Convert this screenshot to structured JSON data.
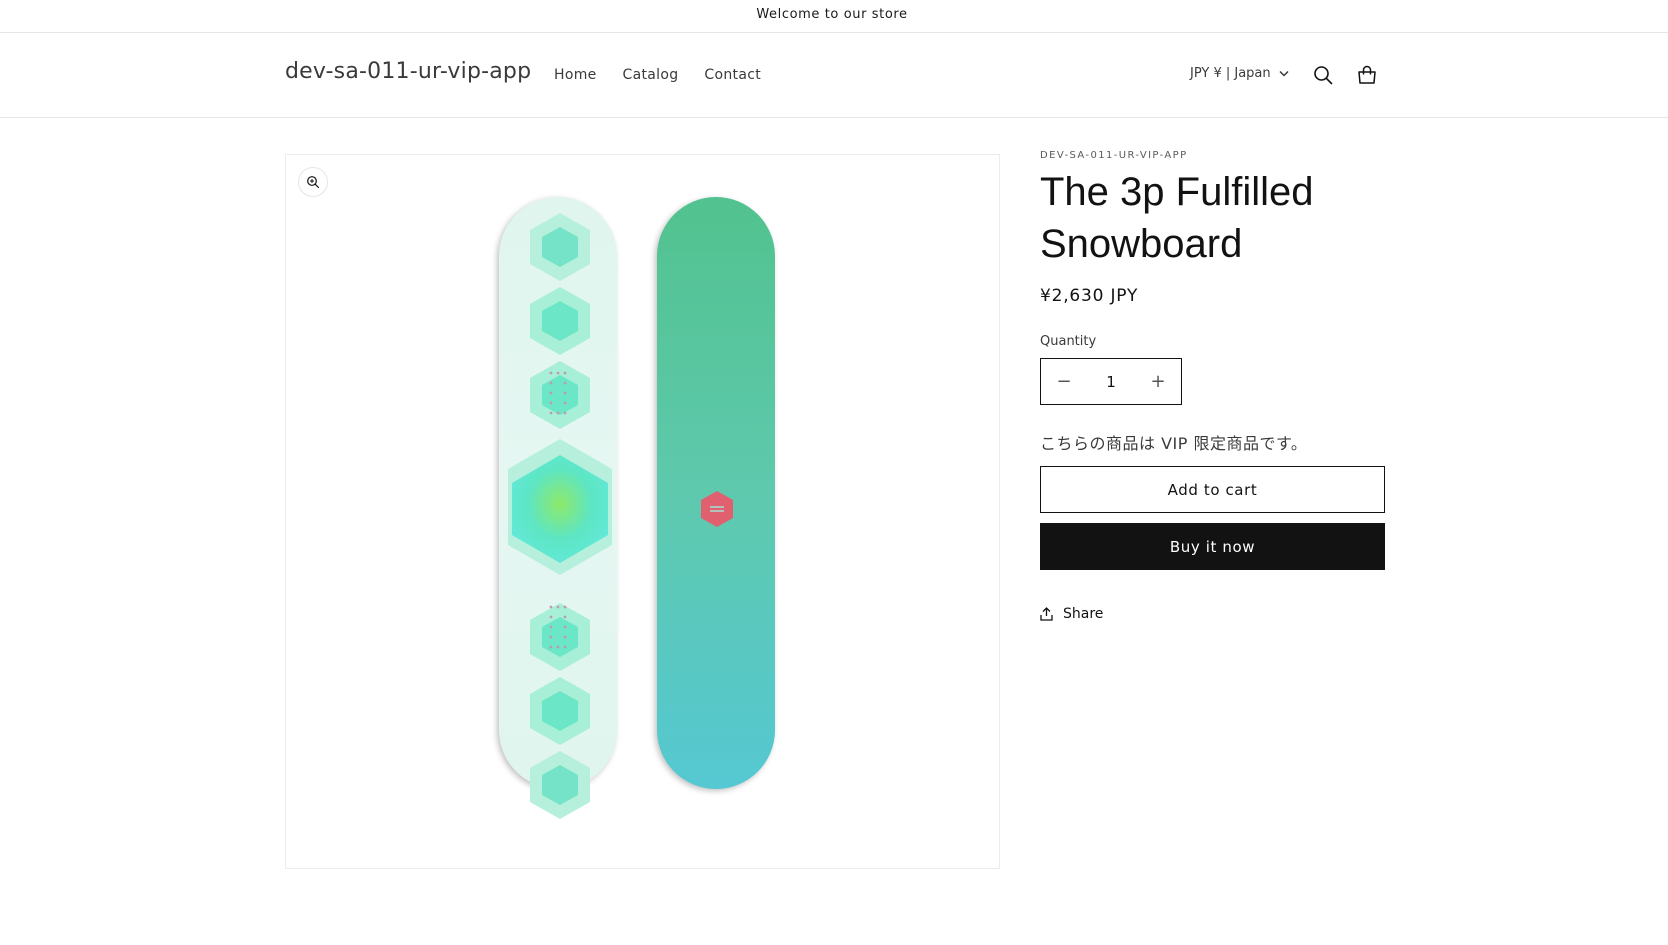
{
  "announcement": {
    "text": "Welcome to our store"
  },
  "header": {
    "store_name": "dev-sa-011-ur-vip-app",
    "nav": [
      {
        "label": "Home"
      },
      {
        "label": "Catalog"
      },
      {
        "label": "Contact"
      }
    ],
    "locale": "JPY ¥ | Japan",
    "icons": {
      "search": "search-icon",
      "cart": "cart-icon",
      "locale_chevron": "chevron-down-icon"
    }
  },
  "product": {
    "vendor": "DEV-SA-011-UR-VIP-APP",
    "title": "The 3p Fulfilled Snowboard",
    "price": "¥2,630 JPY",
    "quantity_label": "Quantity",
    "quantity": "1",
    "quantity_decrease": "−",
    "quantity_increase": "+",
    "vip_note": "こちらの商品は VIP 限定商品です。",
    "add_to_cart": "Add to cart",
    "buy_now": "Buy it now",
    "share": "Share",
    "image": {
      "icon": "snowboard-image",
      "zoom_icon": "zoom-icon"
    }
  },
  "colors": {
    "text": "#121212",
    "border": "#e5e5e5",
    "button_dark": "#121212",
    "board_mint": "#5de6c4",
    "board_teal": "#5ac8a8",
    "logo_red": "#e06070"
  }
}
